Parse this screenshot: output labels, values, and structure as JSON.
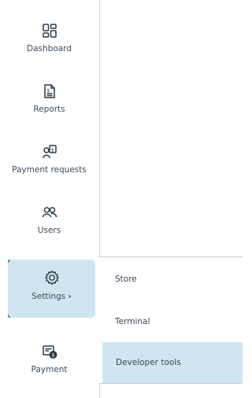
{
  "sidebar": {
    "items": [
      {
        "label": "Dashboard",
        "icon": "dashboard-icon"
      },
      {
        "label": "Reports",
        "icon": "reports-icon"
      },
      {
        "label": "Payment requests",
        "icon": "payment-requests-icon"
      },
      {
        "label": "Users",
        "icon": "users-icon"
      },
      {
        "label": "Settings",
        "icon": "settings-icon",
        "chevron": "›",
        "active": true
      },
      {
        "label": "Payment",
        "icon": "payment-icon"
      }
    ]
  },
  "submenu": {
    "items": [
      {
        "label": "Store"
      },
      {
        "label": "Terminal"
      },
      {
        "label": "Developer tools",
        "highlighted": true
      }
    ]
  },
  "colors": {
    "active_bg": "#cfe6f1",
    "active_bar": "#1a3a55",
    "icon": "#2e3a45"
  }
}
